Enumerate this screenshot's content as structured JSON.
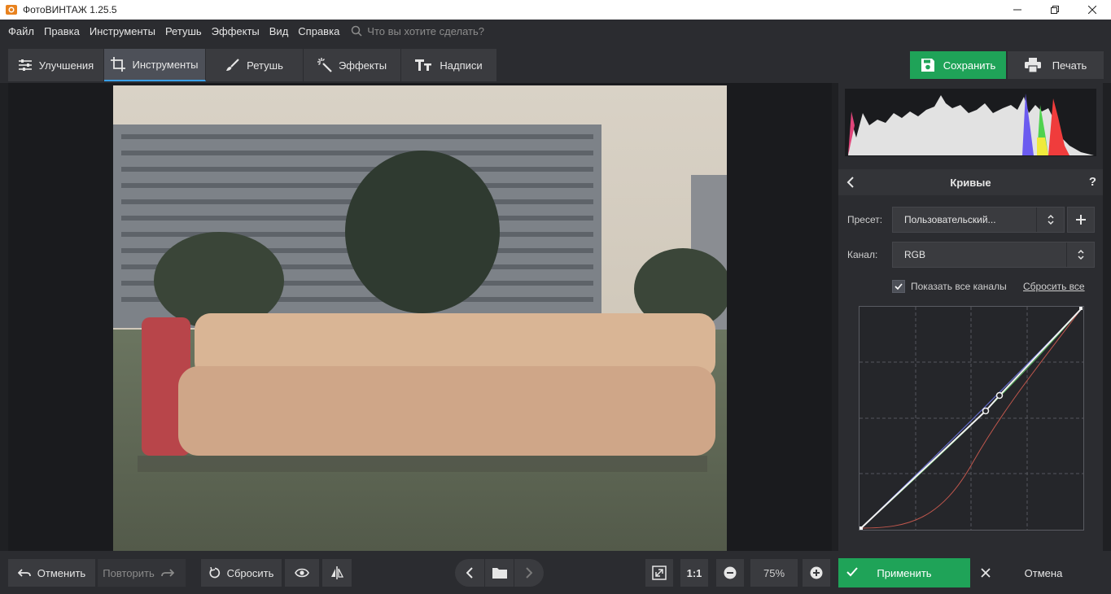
{
  "window": {
    "title": "ФотоВИНТАЖ 1.25.5"
  },
  "menu": {
    "items": [
      "Файл",
      "Правка",
      "Инструменты",
      "Ретушь",
      "Эффекты",
      "Вид",
      "Справка"
    ],
    "search_placeholder": "Что вы хотите сделать?"
  },
  "tabs": [
    {
      "label": "Улучшения",
      "icon": "sliders-icon"
    },
    {
      "label": "Инструменты",
      "icon": "crop-icon",
      "active": true
    },
    {
      "label": "Ретушь",
      "icon": "brush-icon"
    },
    {
      "label": "Эффекты",
      "icon": "magic-wand-icon"
    },
    {
      "label": "Надписи",
      "icon": "text-icon"
    }
  ],
  "actions": {
    "save_label": "Сохранить",
    "print_label": "Печать"
  },
  "panel": {
    "title": "Кривые",
    "help": "?",
    "preset_label": "Пресет:",
    "preset_value": "Пользовательский...",
    "channel_label": "Канал:",
    "channel_value": "RGB",
    "show_all_channels": "Показать все каналы",
    "show_all_checked": true,
    "reset_all": "Сбросить все"
  },
  "bottom": {
    "undo_label": "Отменить",
    "redo_label": "Повторить",
    "reset_label": "Сбросить",
    "zoom_fit": "1:1",
    "zoom_value": "75%",
    "apply_label": "Применить",
    "cancel_label": "Отмена"
  },
  "colors": {
    "accent_green": "#1fa358",
    "tab_active_underline": "#3aa0e8",
    "bg_dark": "#2b2c30"
  }
}
